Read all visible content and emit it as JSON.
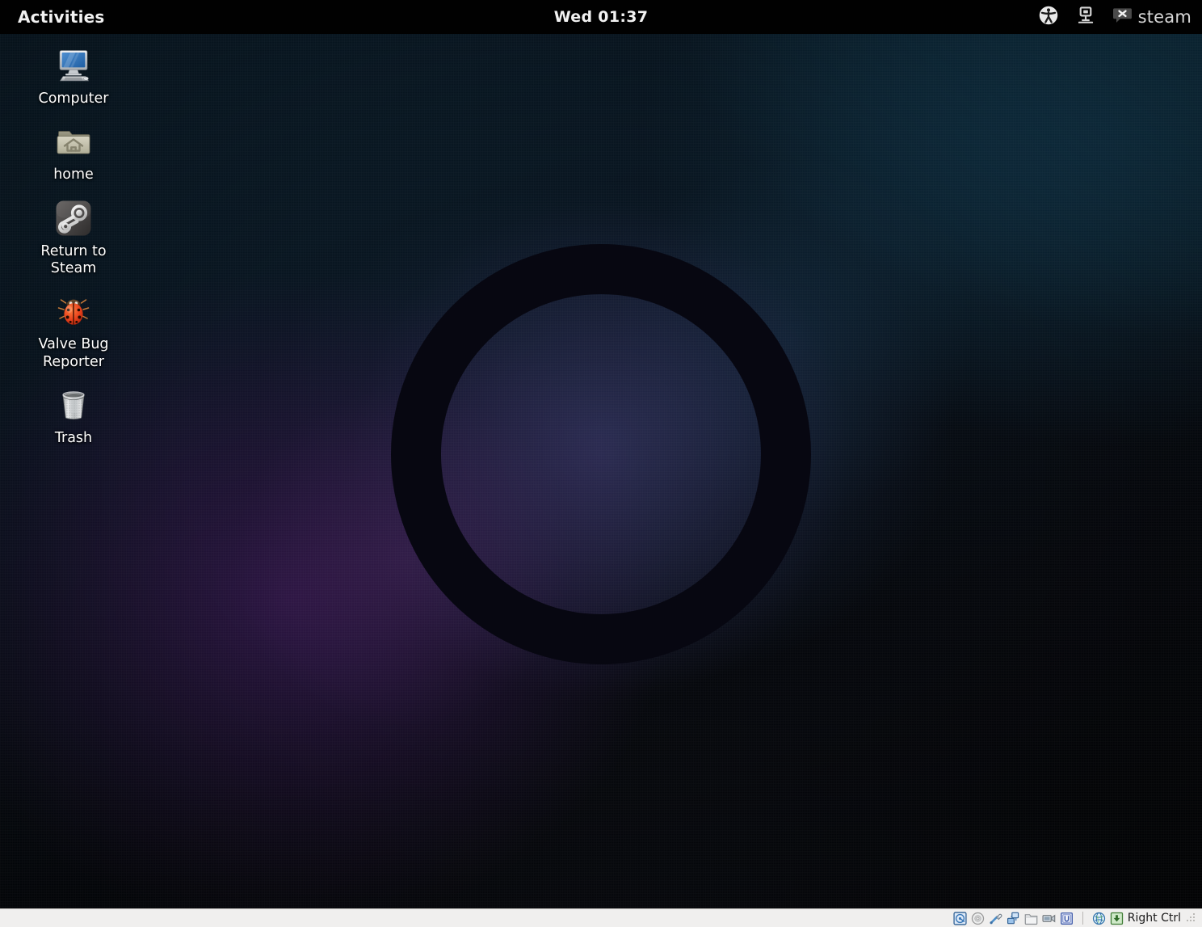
{
  "topbar": {
    "activities_label": "Activities",
    "clock": "Wed 01:37",
    "tray": {
      "accessibility_icon": "accessibility-icon",
      "network_icon": "network-computer-icon",
      "steam_badge_icon": "steam-notification-badge-icon",
      "steam_label": "steam"
    }
  },
  "desktop": {
    "wallpaper": {
      "name": "steamos-ring-wallpaper",
      "ring_color": "#070711",
      "accent_purple": "#5c428c",
      "accent_teal": "#10394f",
      "base_color": "#050608"
    },
    "icons": [
      {
        "id": "computer",
        "label": "Computer",
        "icon": "computer-monitor-icon"
      },
      {
        "id": "home",
        "label": "home",
        "icon": "home-folder-icon"
      },
      {
        "id": "steam",
        "label": "Return to Steam",
        "icon": "steam-logo-icon"
      },
      {
        "id": "bugreport",
        "label": "Valve Bug Reporter",
        "icon": "ladybug-icon"
      },
      {
        "id": "trash",
        "label": "Trash",
        "icon": "trash-bin-icon"
      }
    ]
  },
  "vbox_status": {
    "indicators": [
      {
        "id": "harddisks",
        "icon": "hard-disk-icon"
      },
      {
        "id": "optical",
        "icon": "optical-disc-icon"
      },
      {
        "id": "usb",
        "icon": "usb-icon"
      },
      {
        "id": "network",
        "icon": "network-adapter-icon"
      },
      {
        "id": "sharedfolders",
        "icon": "shared-folder-icon"
      },
      {
        "id": "display",
        "icon": "display-capture-icon"
      },
      {
        "id": "features",
        "icon": "vm-features-chip-icon"
      },
      {
        "id": "remotedesktop",
        "icon": "globe-remote-display-icon"
      },
      {
        "id": "mouse",
        "icon": "mouse-integration-icon"
      }
    ],
    "host_key": "Right Ctrl",
    "resize_grip": "resize-grip"
  }
}
